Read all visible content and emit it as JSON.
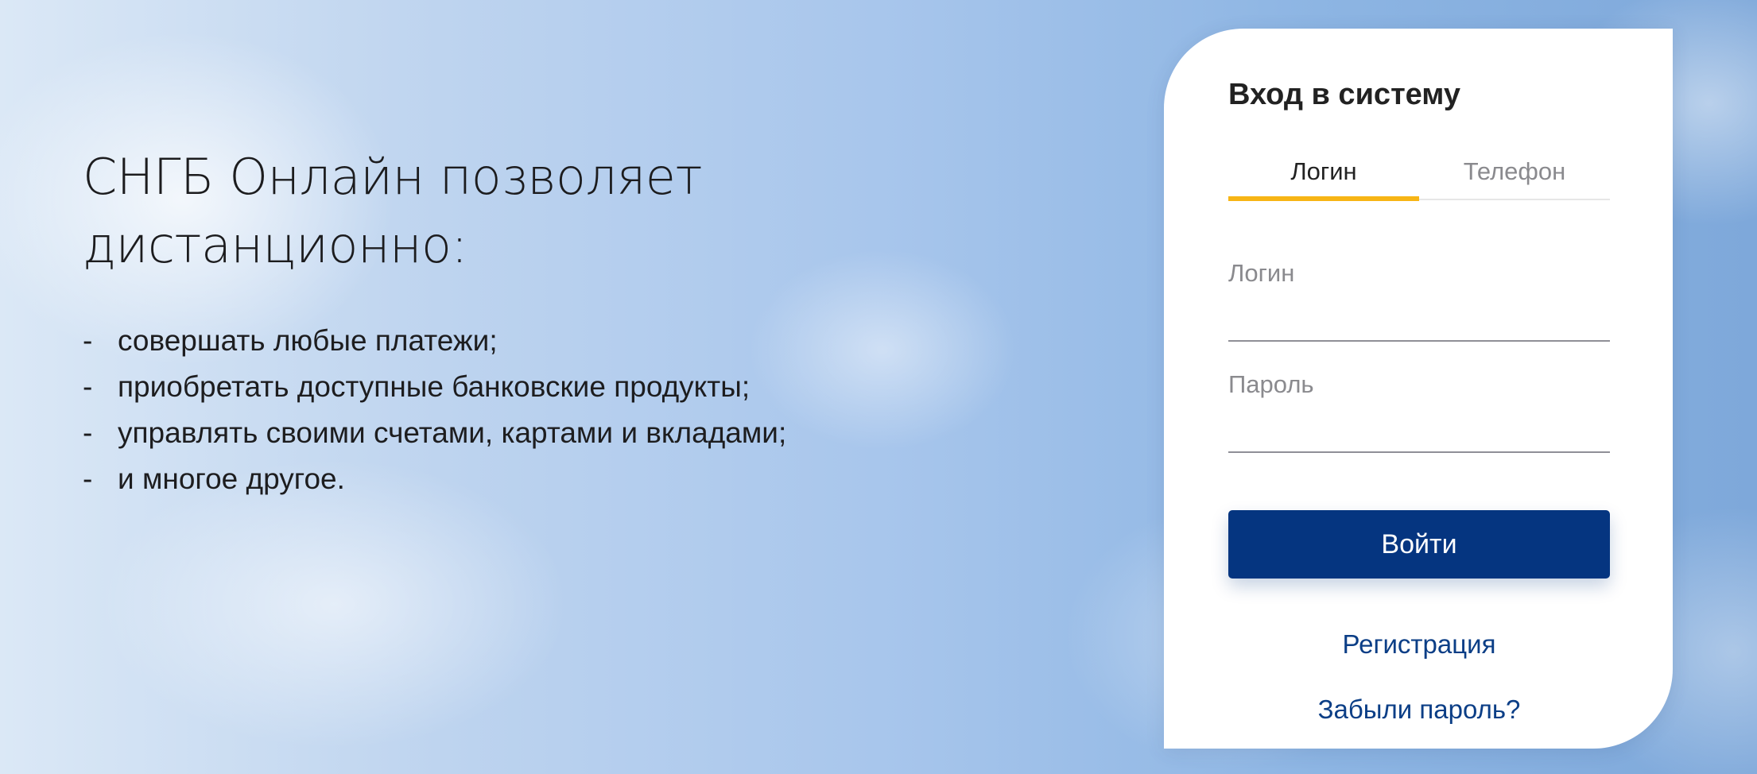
{
  "promo": {
    "title_line1": "СНГБ Онлайн позволяет",
    "title_line2": "дистанционно:",
    "dash": "-",
    "features": [
      "совершать любые платежи;",
      "приобретать доступные банковские продукты;",
      "управлять своими счетами, картами и вкладами;",
      "и многое другое."
    ]
  },
  "login": {
    "title": "Вход в систему",
    "tabs": [
      {
        "label": "Логин",
        "active": true
      },
      {
        "label": "Телефон",
        "active": false
      }
    ],
    "login_field": {
      "label": "Логин",
      "value": ""
    },
    "password_field": {
      "label": "Пароль",
      "value": ""
    },
    "submit_label": "Войти",
    "register_link": "Регистрация",
    "forgot_link": "Забыли пароль?"
  },
  "colors": {
    "accent_tab": "#f7b515",
    "primary_button": "#053580",
    "link": "#0b3e86"
  }
}
